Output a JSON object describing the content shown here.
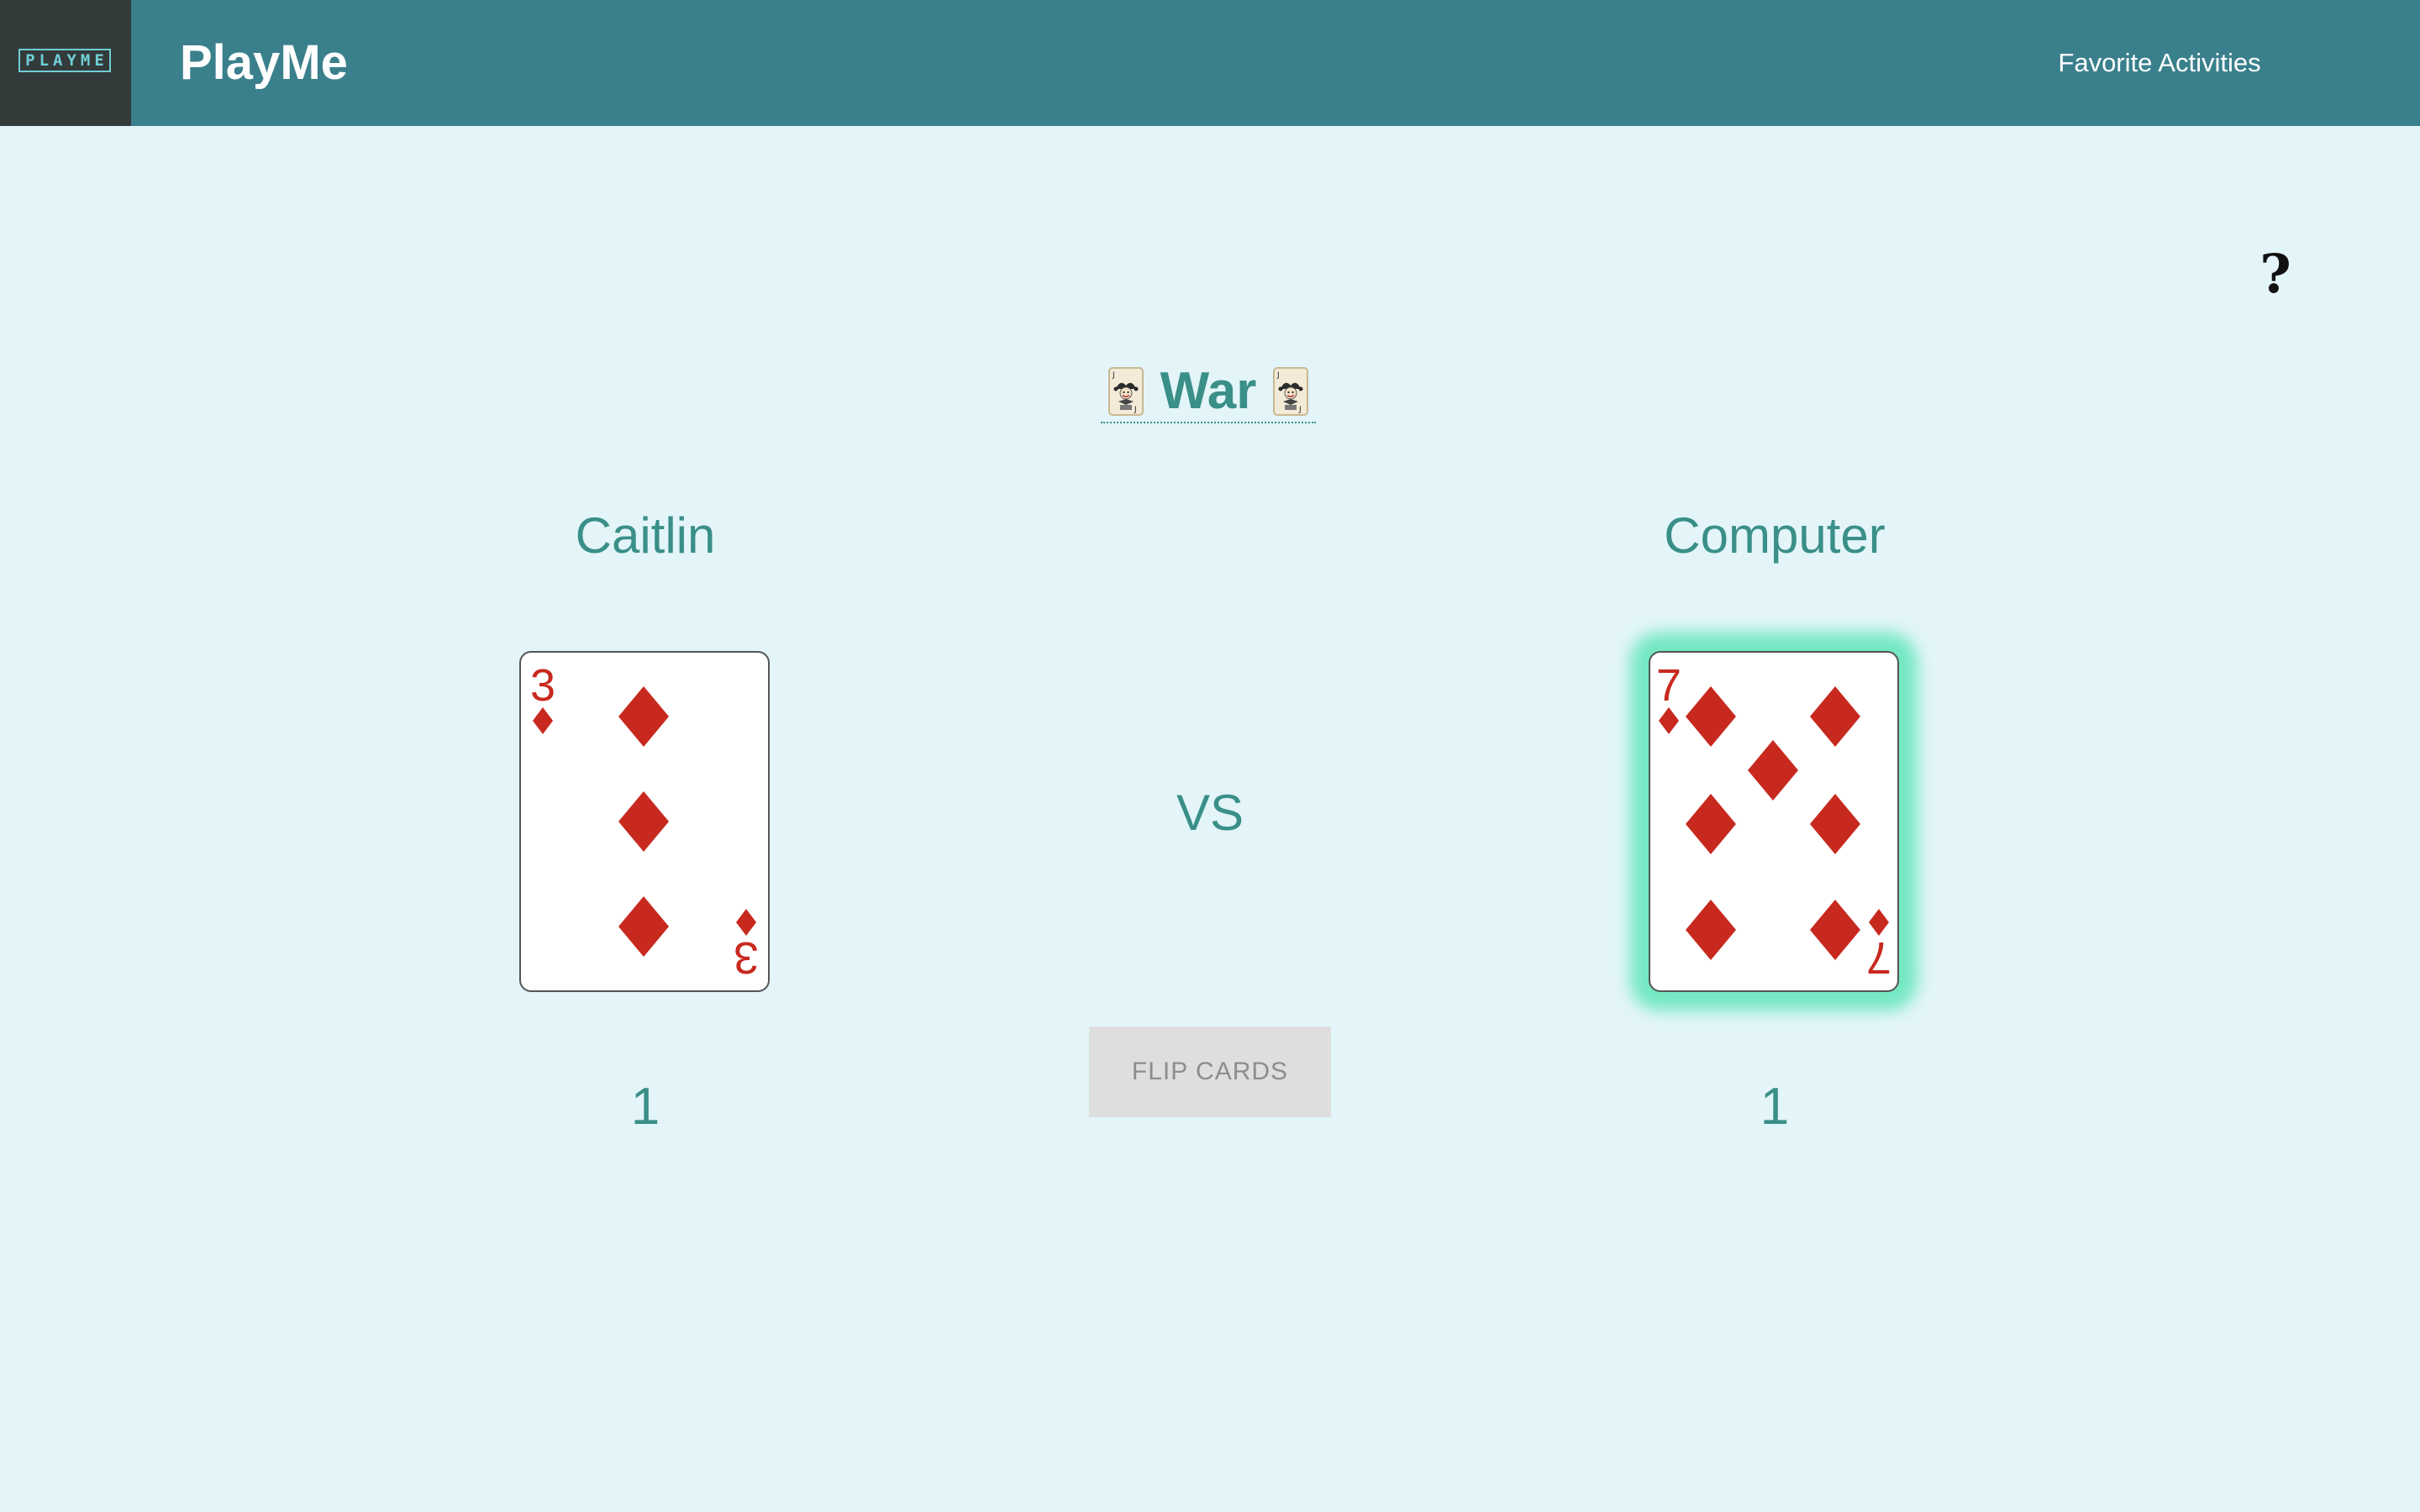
{
  "header": {
    "logo_text": "PLAYME",
    "app_title": "PlayMe",
    "nav_link": "Favorite Activities"
  },
  "help": {
    "symbol": "?"
  },
  "game": {
    "title": "War",
    "title_icon": "joker-card-icon",
    "vs_label": "VS",
    "flip_button": "FLIP CARDS",
    "flip_button_enabled": false
  },
  "players": [
    {
      "name": "Caitlin",
      "card": {
        "rank": "3",
        "suit": "diamonds",
        "suit_symbol": "♦"
      },
      "score": "1",
      "highlighted": false
    },
    {
      "name": "Computer",
      "card": {
        "rank": "7",
        "suit": "diamonds",
        "suit_symbol": "♦"
      },
      "score": "1",
      "highlighted": true
    }
  ],
  "colors": {
    "navbar": "#3a808c",
    "logo_bg": "#333a3a",
    "page_bg": "#e3f5f9",
    "accent_text": "#3a8f88",
    "card_suit_red": "#c8291f",
    "winner_glow": "#74e8c3",
    "button_disabled_bg": "#dedede"
  }
}
